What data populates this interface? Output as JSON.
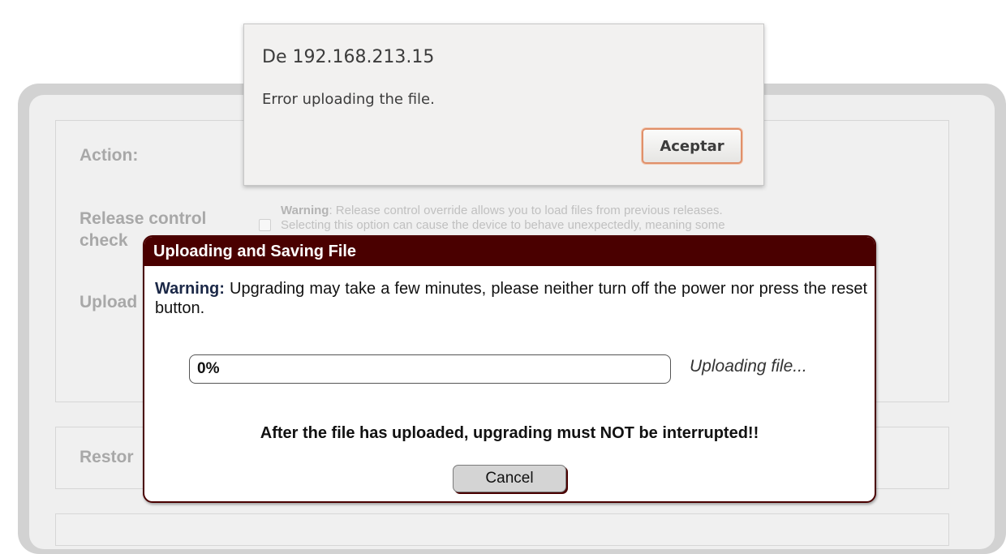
{
  "background": {
    "labels": {
      "action": "Action:",
      "release_control_line1": "Release control",
      "release_control_line2": "check",
      "upload": "Upload",
      "restore": "Restor"
    },
    "release_warning": {
      "bold": "Warning",
      "line1": ": Release control override allows you to load files from previous releases.",
      "line2": "Selecting this option can cause the device to behave unexpectedly, meaning some"
    }
  },
  "alert": {
    "origin": "De 192.168.213.15",
    "message": "Error uploading the file.",
    "ok_label": "Aceptar"
  },
  "modal": {
    "title": "Uploading and Saving File",
    "warning_bold": "Warning:",
    "warning_text": " Upgrading may take a few minutes, please neither turn off the power nor press the reset button.",
    "progress": {
      "percent": 0,
      "label": "0%"
    },
    "status": "Uploading file...",
    "notice": "After the file has uploaded, upgrading must NOT be interrupted!!",
    "cancel_label": "Cancel"
  }
}
